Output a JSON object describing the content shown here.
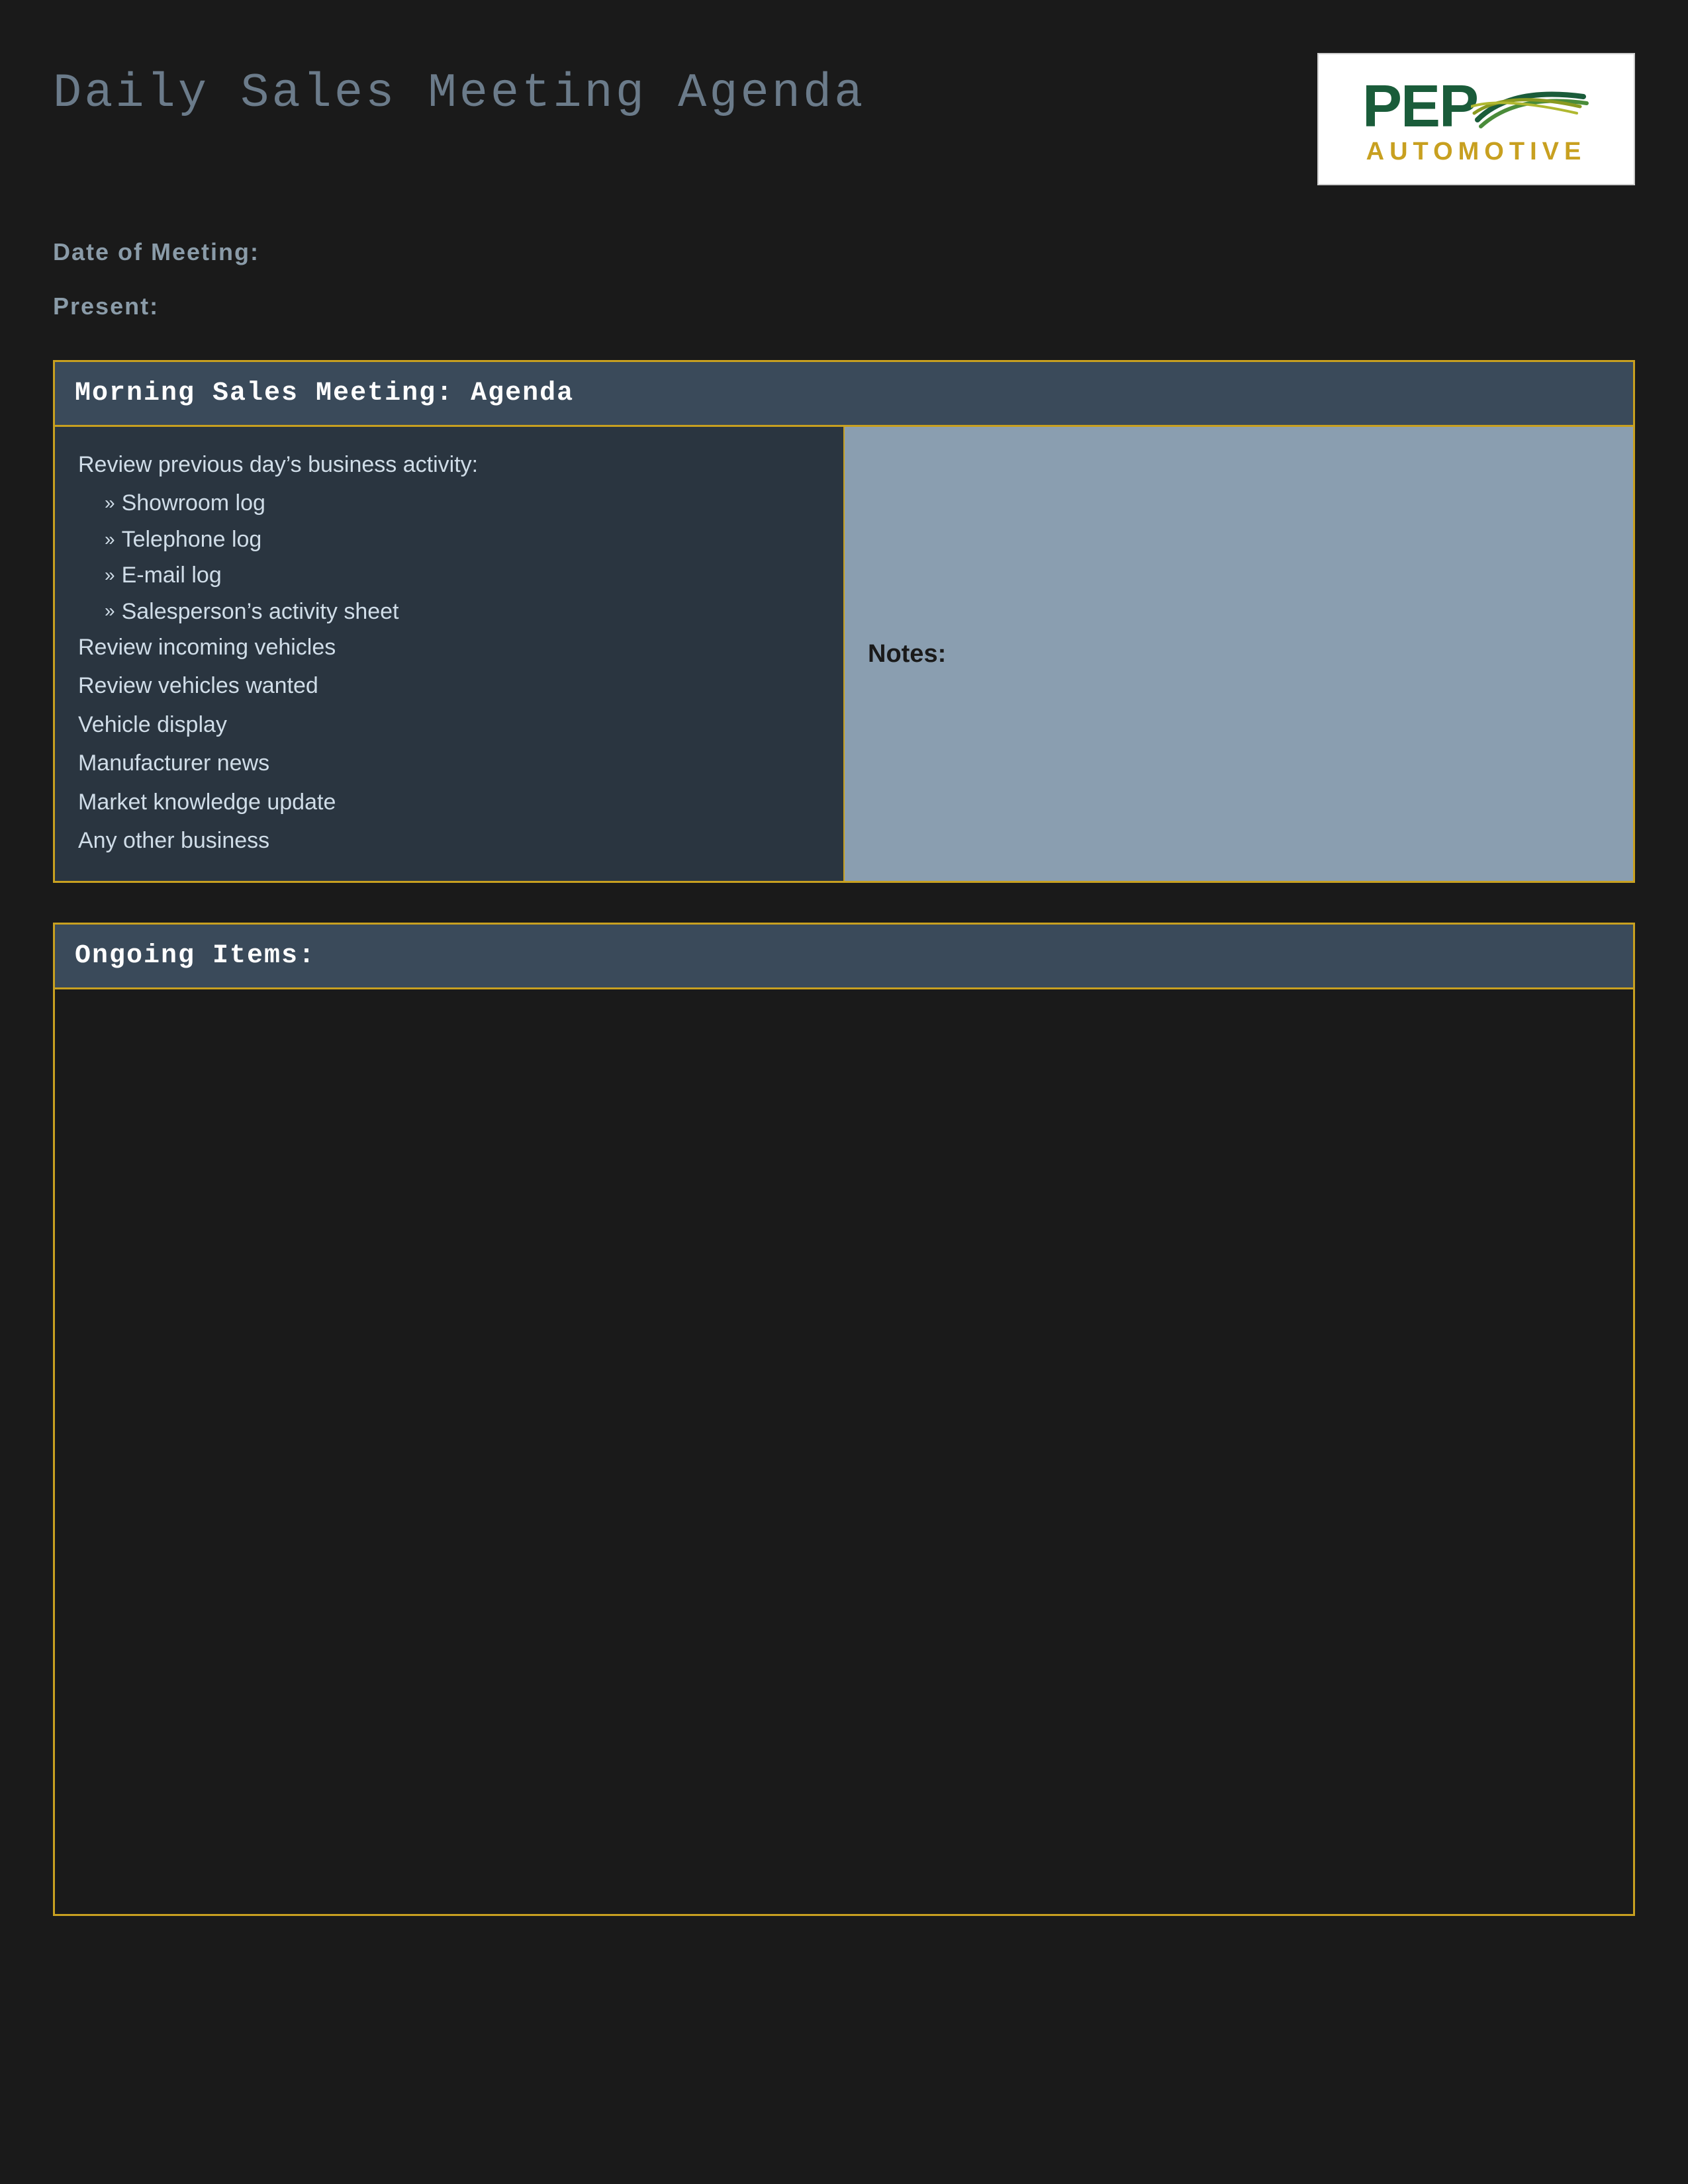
{
  "page": {
    "title": "Daily Sales Meeting Agenda",
    "background_color": "#1a1a1a"
  },
  "logo": {
    "pep_text": "PEP",
    "automotive_text": "AUTOMOTIVE"
  },
  "meta": {
    "date_label": "Date of Meeting:",
    "present_label": "Present:"
  },
  "morning_meeting": {
    "header": "Morning Sales Meeting: Agenda",
    "agenda_intro": "Review previous day’s business activity:",
    "sub_items": [
      "Showroom log",
      "Telephone log",
      "E-mail log",
      "Salesperson’s activity sheet"
    ],
    "items": [
      "Review incoming vehicles",
      "Review vehicles wanted",
      "Vehicle display",
      "Manufacturer news",
      "Market knowledge update",
      "Any other business"
    ],
    "notes_label": "Notes:"
  },
  "ongoing": {
    "header": "Ongoing Items:"
  }
}
